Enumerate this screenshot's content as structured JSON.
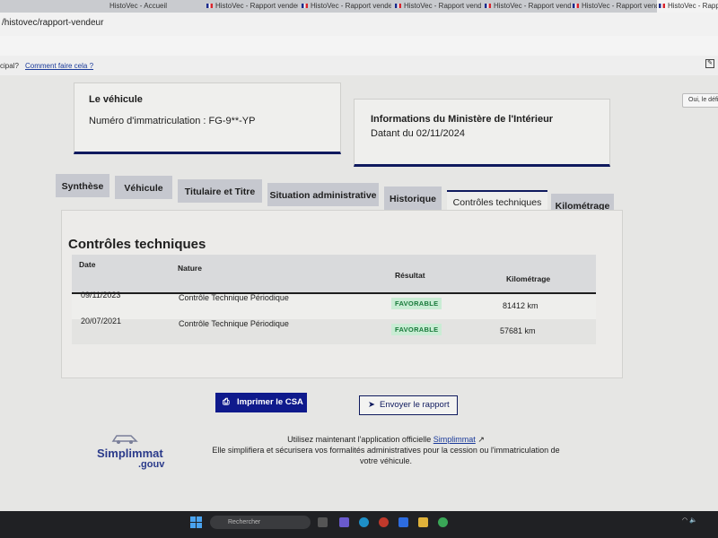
{
  "browser": {
    "tabs": [
      {
        "label": "HistoVec - Accueil"
      },
      {
        "label": "HistoVec - Rapport vendeur"
      },
      {
        "label": "HistoVec - Rapport vendeur"
      },
      {
        "label": "HistoVec - Rapport vendeur"
      },
      {
        "label": "HistoVec - Rapport vendeur"
      },
      {
        "label": "HistoVec - Rapport vendeur"
      },
      {
        "label": "HistoVec - Rapport vendeur"
      }
    ],
    "url": "/histovec/rapport-vendeur",
    "bookmarks": [
      "cipal?",
      "Comment faire cela ?"
    ],
    "side_button": "Oui, le défini"
  },
  "vehicle_card": {
    "title": "Le véhicule",
    "plate_label": "Numéro d'immatriculation : FG-9**-YP"
  },
  "ministry_card": {
    "title": "Informations du Ministère de l'Intérieur",
    "date": "Datant du 02/11/2024"
  },
  "tabs": [
    {
      "label": "Synthèse"
    },
    {
      "label": "Véhicule"
    },
    {
      "label": "Titulaire et Titre"
    },
    {
      "label": "Situation administrative"
    },
    {
      "label": "Historique"
    },
    {
      "label": "Contrôles techniques"
    },
    {
      "label": "Kilométrage"
    }
  ],
  "section": {
    "title": "Contrôles techniques",
    "columns": [
      "Date",
      "Nature",
      "Résultat",
      "Kilométrage"
    ],
    "rows": [
      {
        "date": "09/11/2023",
        "nature": "Contrôle Technique Périodique",
        "result": "FAVORABLE",
        "km": "81412 km"
      },
      {
        "date": "20/07/2021",
        "nature": "Contrôle Technique Périodique",
        "result": "FAVORABLE",
        "km": "57681 km"
      }
    ]
  },
  "actions": {
    "print": "Imprimer le CSA",
    "send": "Envoyer le rapport"
  },
  "footer": {
    "logo_main": "Simplimmat",
    "logo_sub": ".gouv",
    "line1_prefix": "Utilisez maintenant l'application officielle",
    "line1_link": "Simplimmat",
    "line2": "Elle simplifiera et sécurisera vos formalités administratives pour la cession ou l'immatriculation de",
    "line3": "votre véhicule."
  },
  "taskbar": {
    "search_placeholder": "Rechercher"
  },
  "colors": {
    "primary": "#0f1a8c",
    "badge_bg": "#c9ecd4",
    "badge_text": "#187a3a"
  }
}
